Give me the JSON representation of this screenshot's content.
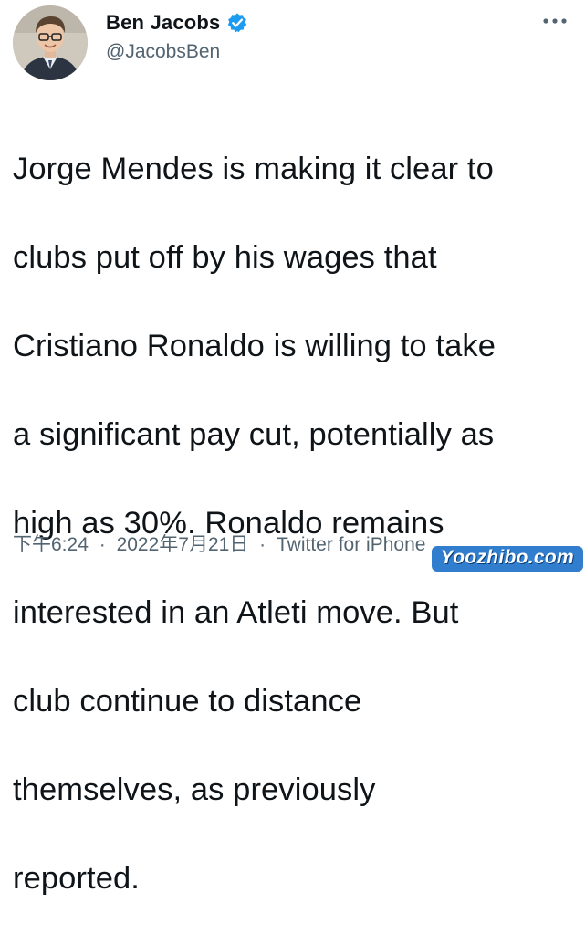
{
  "user": {
    "display_name": "Ben Jacobs",
    "handle": "@JacobsBen",
    "verified": true
  },
  "tweet": {
    "text_lines": [
      "Jorge Mendes is making it clear to",
      "clubs put off by his wages that",
      "Cristiano Ronaldo is willing to take",
      "a significant pay cut, potentially as",
      "high as 30%. Ronaldo remains",
      "interested in an Atleti move. But",
      "club continue to distance",
      "themselves, as previously",
      "reported."
    ]
  },
  "meta": {
    "time": "下午6:24",
    "date": "2022年7月21日",
    "separator": "·",
    "source": "Twitter for iPhone"
  },
  "watermark": "Yoozhibo.com",
  "icons": {
    "verified": "verified-badge-icon",
    "more": "more-options-icon"
  },
  "colors": {
    "text": "#0f1419",
    "secondary": "#536471",
    "verified": "#1d9bf0",
    "watermark_bg": "#1b70c9"
  }
}
